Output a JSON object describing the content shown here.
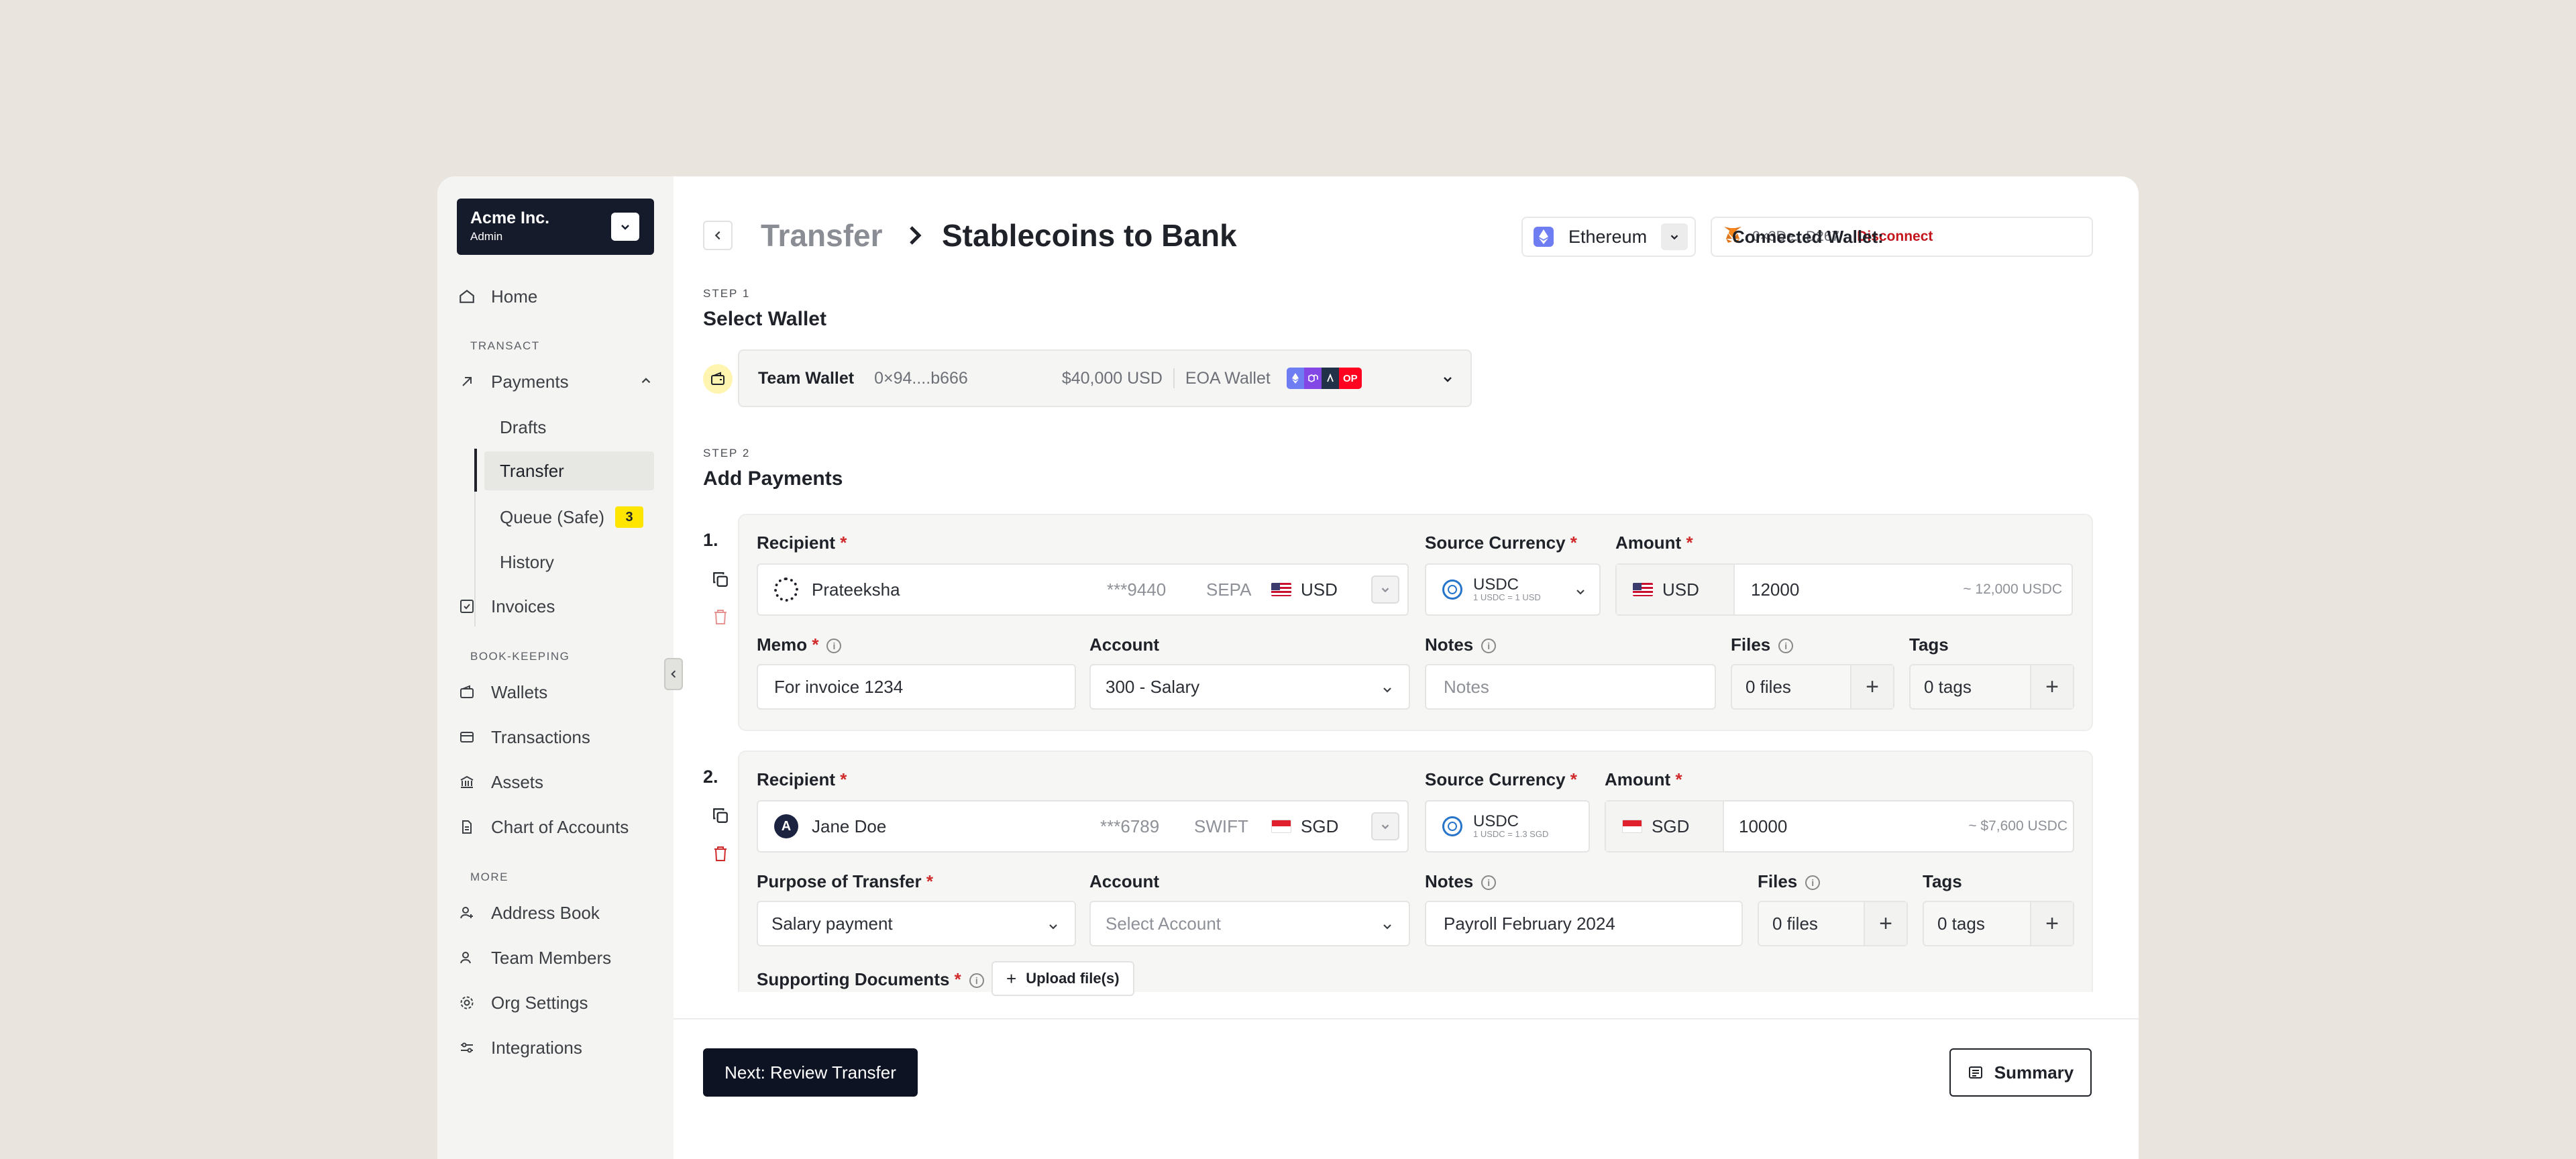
{
  "org": {
    "name": "Acme Inc.",
    "role": "Admin"
  },
  "sidebar": {
    "home": "Home",
    "transact_section": "TRANSACT",
    "payments": "Payments",
    "payments_sub": [
      "Drafts",
      "Transfer",
      "Queue (Safe)",
      "History"
    ],
    "queue_badge": "3",
    "invoices": "Invoices",
    "bookkeeping_section": "BOOK-KEEPING",
    "wallets": "Wallets",
    "transactions": "Transactions",
    "assets": "Assets",
    "chart_of_accounts": "Chart of Accounts",
    "more_section": "MORE",
    "address_book": "Address Book",
    "team_members": "Team Members",
    "org_settings": "Org Settings",
    "integrations": "Integrations"
  },
  "header": {
    "breadcrumb_parent": "Transfer",
    "breadcrumb_current": "Stablecoins to Bank",
    "network": "Ethereum",
    "wallet_label": "Connected Wallet:",
    "wallet_address": "0×3De...D267",
    "disconnect": "Disconnect"
  },
  "step1": {
    "step": "STEP 1",
    "title": "Select Wallet",
    "wallet_name": "Team Wallet",
    "wallet_address": "0×94....b666",
    "balance": "$40,000 USD",
    "wallet_type": "EOA Wallet",
    "chain_chip": "OP"
  },
  "step2": {
    "step": "STEP 2",
    "title": "Add Payments"
  },
  "labels": {
    "recipient": "Recipient",
    "source_currency": "Source Currency",
    "amount": "Amount",
    "memo": "Memo",
    "account": "Account",
    "notes": "Notes",
    "files": "Files",
    "tags": "Tags",
    "purpose": "Purpose of Transfer",
    "supporting_documents": "Supporting Documents",
    "upload": "Upload file(s)",
    "required": "*",
    "info": "i"
  },
  "payments": [
    {
      "number": "1.",
      "recipient": "Prateeksha",
      "account_mask": "***9440",
      "rail": "SEPA",
      "currency": "USD",
      "source_currency": "USDC",
      "source_rate": "1 USDC = 1 USD",
      "amount_currency": "USD",
      "amount": "12000",
      "estimate": "~ 12,000 USDC",
      "memo": "For invoice 1234",
      "account": "300 - Salary",
      "notes_placeholder": "Notes",
      "files": "0 files",
      "tags": "0 tags"
    },
    {
      "number": "2.",
      "recipient_initial": "A",
      "recipient": "Jane Doe",
      "account_mask": "***6789",
      "rail": "SWIFT",
      "currency": "SGD",
      "source_currency": "USDC",
      "source_rate": "1 USDC = 1.3 SGD",
      "amount_currency": "SGD",
      "amount": "10000",
      "estimate": "~ $7,600 USDC",
      "purpose": "Salary payment",
      "account_placeholder": "Select Account",
      "notes": "Payroll February 2024",
      "files": "0 files",
      "tags": "0 tags"
    }
  ],
  "footer": {
    "next": "Next: Review Transfer",
    "summary": "Summary"
  },
  "colors": {
    "brand_dark": "#0d1322",
    "required": "#d12a2a",
    "disconnect": "#c4151c",
    "badge": "#ffe500"
  }
}
